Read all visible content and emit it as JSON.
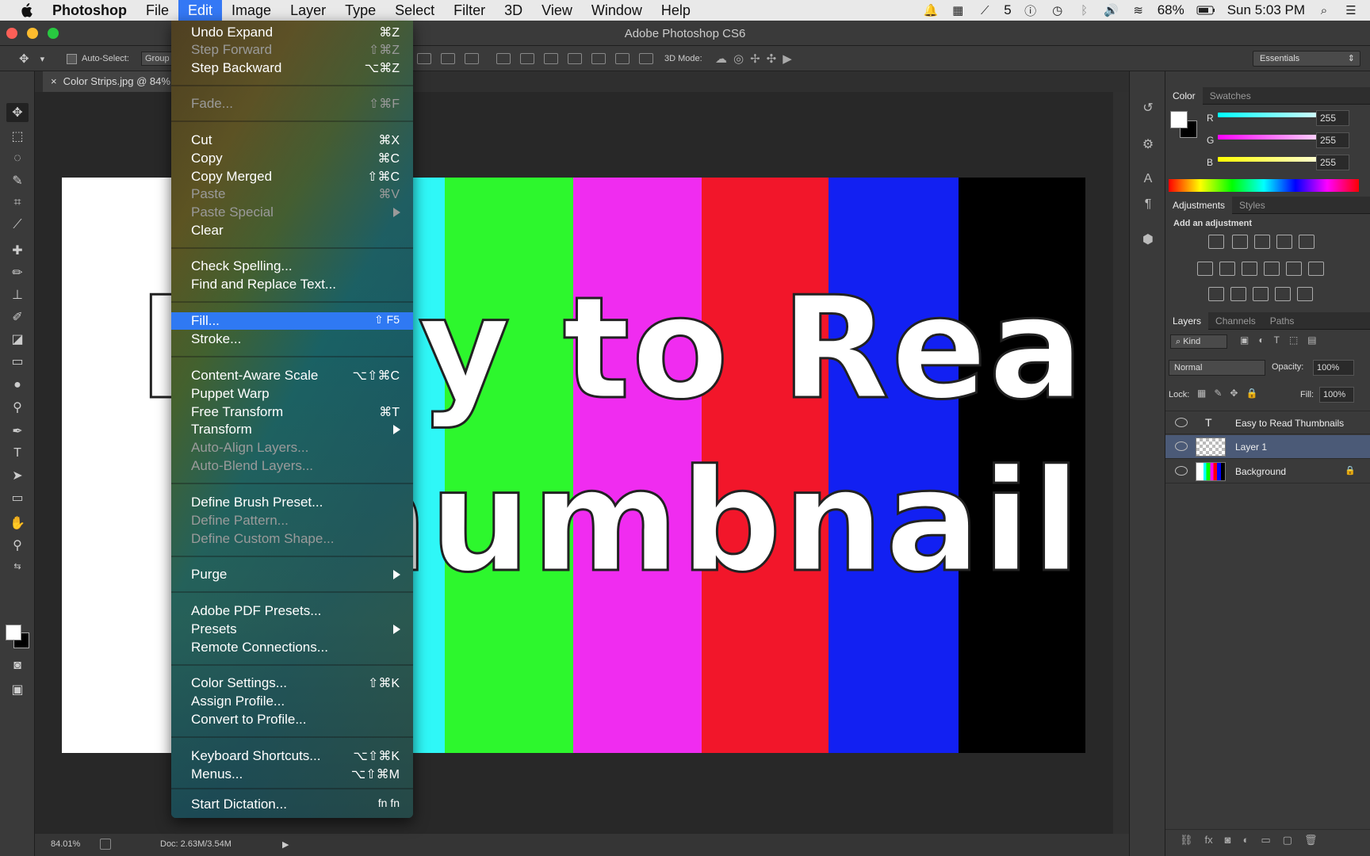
{
  "menubar": {
    "app": "Photoshop",
    "items": [
      "File",
      "Edit",
      "Image",
      "Layer",
      "Type",
      "Select",
      "Filter",
      "3D",
      "View",
      "Window",
      "Help"
    ],
    "status": {
      "badge_count": "5",
      "battery": "68%",
      "clock": "Sun 5:03 PM"
    }
  },
  "window": {
    "title": "Adobe Photoshop CS6"
  },
  "options_bar": {
    "auto_select_label": "Auto-Select:",
    "auto_select_value": "Group",
    "mode_3d_label": "3D Mode:",
    "workspace": "Essentials"
  },
  "document": {
    "tab_title": "Color Strips.jpg @ 84%",
    "zoom": "84.01%",
    "doc_size": "Doc: 2.63M/3.54M",
    "text_line1": "Easy to Read",
    "text_line2": "Thumbnails"
  },
  "edit_menu": {
    "items": [
      {
        "label": "Undo Expand",
        "shortcut": "⌘Z",
        "enabled": true
      },
      {
        "label": "Step Forward",
        "shortcut": "⇧⌘Z",
        "enabled": false
      },
      {
        "label": "Step Backward",
        "shortcut": "⌥⌘Z",
        "enabled": true
      },
      {
        "label": "Fade...",
        "shortcut": "⇧⌘F",
        "enabled": false
      },
      {
        "label": "Cut",
        "shortcut": "⌘X",
        "enabled": true
      },
      {
        "label": "Copy",
        "shortcut": "⌘C",
        "enabled": true
      },
      {
        "label": "Copy Merged",
        "shortcut": "⇧⌘C",
        "enabled": true
      },
      {
        "label": "Paste",
        "shortcut": "⌘V",
        "enabled": false
      },
      {
        "label": "Paste Special",
        "shortcut": "",
        "enabled": false,
        "submenu": true
      },
      {
        "label": "Clear",
        "shortcut": "",
        "enabled": true
      },
      {
        "label": "Check Spelling...",
        "shortcut": "",
        "enabled": true
      },
      {
        "label": "Find and Replace Text...",
        "shortcut": "",
        "enabled": true
      },
      {
        "label": "Fill...",
        "shortcut": "⇧ F5",
        "enabled": true,
        "highlighted": true
      },
      {
        "label": "Stroke...",
        "shortcut": "",
        "enabled": true
      },
      {
        "label": "Content-Aware Scale",
        "shortcut": "⌥⇧⌘C",
        "enabled": true
      },
      {
        "label": "Puppet Warp",
        "shortcut": "",
        "enabled": true
      },
      {
        "label": "Free Transform",
        "shortcut": "⌘T",
        "enabled": true
      },
      {
        "label": "Transform",
        "shortcut": "",
        "enabled": true,
        "submenu": true
      },
      {
        "label": "Auto-Align Layers...",
        "shortcut": "",
        "enabled": false
      },
      {
        "label": "Auto-Blend Layers...",
        "shortcut": "",
        "enabled": false
      },
      {
        "label": "Define Brush Preset...",
        "shortcut": "",
        "enabled": true
      },
      {
        "label": "Define Pattern...",
        "shortcut": "",
        "enabled": false
      },
      {
        "label": "Define Custom Shape...",
        "shortcut": "",
        "enabled": false
      },
      {
        "label": "Purge",
        "shortcut": "",
        "enabled": true,
        "submenu": true
      },
      {
        "label": "Adobe PDF Presets...",
        "shortcut": "",
        "enabled": true
      },
      {
        "label": "Presets",
        "shortcut": "",
        "enabled": true,
        "submenu": true
      },
      {
        "label": "Remote Connections...",
        "shortcut": "",
        "enabled": true
      },
      {
        "label": "Color Settings...",
        "shortcut": "⇧⌘K",
        "enabled": true
      },
      {
        "label": "Assign Profile...",
        "shortcut": "",
        "enabled": true
      },
      {
        "label": "Convert to Profile...",
        "shortcut": "",
        "enabled": true
      },
      {
        "label": "Keyboard Shortcuts...",
        "shortcut": "⌥⇧⌘K",
        "enabled": true
      },
      {
        "label": "Menus...",
        "shortcut": "⌥⇧⌘M",
        "enabled": true
      },
      {
        "label": "Start Dictation...",
        "shortcut": "fn fn",
        "enabled": true
      }
    ]
  },
  "color_panel": {
    "tabs": [
      "Color",
      "Swatches"
    ],
    "r_label": "R",
    "g_label": "G",
    "b_label": "B",
    "r": "255",
    "g": "255",
    "b": "255"
  },
  "adjustments_panel": {
    "tabs": [
      "Adjustments",
      "Styles"
    ],
    "heading": "Add an adjustment"
  },
  "layers_panel": {
    "tabs": [
      "Layers",
      "Channels",
      "Paths"
    ],
    "filter": "Kind",
    "blend_mode": "Normal",
    "opacity_label": "Opacity:",
    "opacity": "100%",
    "lock_label": "Lock:",
    "fill_label": "Fill:",
    "fill": "100%",
    "layers": [
      {
        "name": "Easy to Read Thumbnails",
        "type": "text"
      },
      {
        "name": "Layer 1",
        "type": "pixel",
        "selected": true
      },
      {
        "name": "Background",
        "type": "image",
        "locked": true
      }
    ]
  },
  "colors": {
    "cyan": "#2ff7f7",
    "green": "#2df72d",
    "magenta": "#f02cf0",
    "red": "#f2162a",
    "blue": "#1220f2",
    "black": "#000000",
    "menu_highlight": "#2f79f3"
  }
}
